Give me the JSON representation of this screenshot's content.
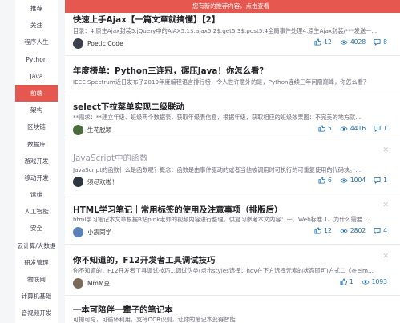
{
  "sidebar": {
    "items": [
      {
        "label": "推荐"
      },
      {
        "label": "关注"
      },
      {
        "label": "程序人生"
      },
      {
        "label": "Python"
      },
      {
        "label": "Java"
      },
      {
        "label": "前端",
        "active": true
      },
      {
        "label": "架构"
      },
      {
        "label": "区块链"
      },
      {
        "label": "数据库"
      },
      {
        "label": "游戏开发"
      },
      {
        "label": "移动开发"
      },
      {
        "label": "运维"
      },
      {
        "label": "人工智能"
      },
      {
        "label": "安全"
      },
      {
        "label": "云计算/大数据"
      },
      {
        "label": "研发管理"
      },
      {
        "label": "物联网"
      },
      {
        "label": "计算机基础"
      },
      {
        "label": "音视频开发"
      },
      {
        "label": "其他"
      }
    ]
  },
  "banner": {
    "text": "您有新的推荐内容，点击查看"
  },
  "articles": [
    {
      "title": "快速上手Ajax【一篇文章就搞懂】【2】",
      "summary": "目录：4.原生Ajax封装5.jQuery中的AJAX5.1$.ajax5.2$.get5.3$.post5.4全局事件处理4.原生Ajax封装/***发送一...",
      "author": "Poetic Code",
      "avatar_color": "#3a3f4a",
      "likes": "12",
      "views": "4028",
      "comments": "8"
    },
    {
      "title": "年度榜单：Python三连冠，碾压Java！你怎么看？",
      "summary": "IEEE Spectrum近日发布了2019年度编程语言排行榜，令人世许意外的是，Python连续三年问鼎巅峰，你怎么看？",
      "author": "",
      "avatar_color": "",
      "likes": "",
      "views": "",
      "comments": ""
    },
    {
      "title": "select下拉菜单实现二级联动",
      "summary": "**需求：**建立年级、班级两个数据表，获取年级表信息，根据年级，获取相应的班级效果图：不完美的地方就...",
      "author": "生花脱颖",
      "avatar_color": "#4a6b3a",
      "likes": "5",
      "views": "4416",
      "comments": "1"
    },
    {
      "title": "JavaScript中的函数",
      "summary": "JavaScript的函数什么是函数呢？概念：函数是由事件驱动的或者当他被调用时可执行的可重复使用的代码块。...",
      "author": "须尽欢啦！",
      "avatar_color": "#2d3640",
      "likes": "6",
      "views": "1004",
      "comments": "1",
      "read": true
    },
    {
      "title": "HTML学习笔记｜常用标签的使用及注意事项（排版后）",
      "summary": "html学习笔记本文章根据B站pink老师的视频内容进行整理，供复习参考本文内容：一、Web标准 1、为什么需要...",
      "author": "小震同学",
      "avatar_color": "#5a82b8",
      "likes": "12",
      "views": "2802",
      "comments": "4"
    },
    {
      "title": "你不知道的，F12开发者工具调试技巧",
      "summary": "你不知道的，F12开发者工具调试技巧1.调试伪类(点击styles选择：hov在下方选择元素的状态即可)方式二（在elm...",
      "author": "MmM豆",
      "avatar_color": "#7a6a58",
      "likes": "1",
      "views": "1093",
      "comments": ""
    },
    {
      "title": "一本可陪伴一辈子的笔记本",
      "summary": "可擦可写，可循环利用，支持OCR识别，让你的笔记本变得智能",
      "author": "",
      "avatar_color": "",
      "likes": "",
      "views": "",
      "comments": ""
    }
  ],
  "colors": {
    "accent": "#e5574f",
    "link": "#1b6fb3"
  },
  "icons": {
    "like": "thumb-up-icon",
    "view": "eye-icon",
    "comment": "comment-icon",
    "close": "close-icon"
  }
}
